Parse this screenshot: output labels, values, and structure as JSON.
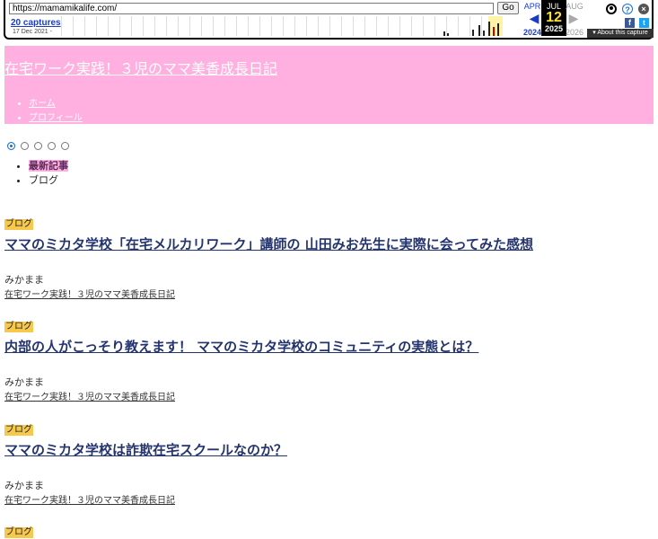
{
  "wayback": {
    "url": "https://mamamikalife.com/",
    "go_label": "Go",
    "captures": "20 captures",
    "range": "17 Dec 2021 -",
    "prev_month": "APR",
    "prev_year": "2024",
    "cur_month": "JUL",
    "cur_day": "12",
    "cur_year": "2025",
    "next_month": "AUG",
    "next_year": "2026",
    "about": "▾ About this capture",
    "prev_arrow": "◀",
    "next_arrow": "▶",
    "help": "?",
    "close": "×",
    "fb": "f",
    "tw": "t"
  },
  "site": {
    "title": "在宅ワーク実践！３児のママ美香成長日記",
    "nav": [
      "ホーム",
      "プロフィール"
    ]
  },
  "slider": {
    "count": 5,
    "active": 0
  },
  "tabs": [
    "最新記事",
    "ブログ"
  ],
  "posts": [
    {
      "category": "ブログ",
      "title": "ママのミカタ学校「在宅メルカリワーク」講師の 山田みお先生に実際に会ってみた感想",
      "author": "みかまま",
      "blog": "在宅ワーク実践！３児のママ美香成長日記"
    },
    {
      "category": "ブログ",
      "title": "内部の人がこっそり教えます！ ママのミカタ学校のコミュニティの実態とは？",
      "author": "みかまま",
      "blog": "在宅ワーク実践！３児のママ美香成長日記"
    },
    {
      "category": "ブログ",
      "title": "ママのミカタ学校は詐欺在宅スクールなのか？",
      "author": "みかまま",
      "blog": "在宅ワーク実践！３児のママ美香成長日記"
    },
    {
      "category": "ブログ"
    }
  ],
  "colors": {
    "header_bg": "#ffb0e0",
    "category_bg": "#f6c84c",
    "title_color": "#24346e"
  }
}
